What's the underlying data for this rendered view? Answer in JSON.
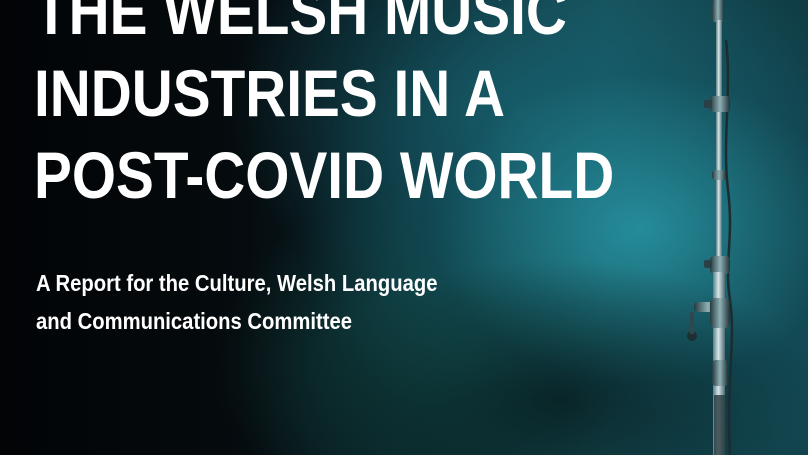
{
  "cover": {
    "title_lines": [
      "THE WELSH MUSIC",
      "INDUSTRIES IN A",
      "POST-COVID WORLD"
    ],
    "subtitle_lines": [
      "A Report for the Culture, Welsh Language",
      "and Communications Committee"
    ]
  },
  "colors": {
    "background_dark": "#03080b",
    "background_teal": "#2896a5",
    "text": "#ffffff"
  },
  "icons": {
    "microphone_stand": "microphone-stand-icon"
  }
}
